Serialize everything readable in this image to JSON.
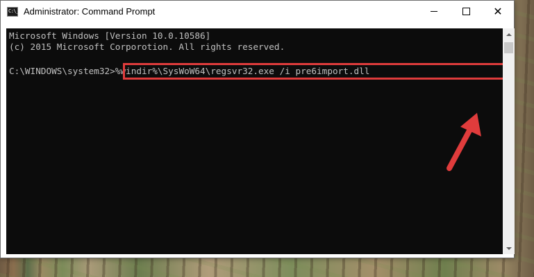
{
  "window": {
    "title": "Administrator: Command Prompt",
    "icon": "command-prompt-icon",
    "icon_glyph": "C:\\_"
  },
  "controls": {
    "minimize": "minimize-icon",
    "maximize": "maximize-icon",
    "close": "close-icon",
    "close_glyph": "✕"
  },
  "console": {
    "lines": [
      "Microsoft Windows [Version 10.0.10586]",
      "(c) 2015 Microsoft Corporotion. All rights reserved."
    ],
    "prompt": "C:\\WINDOWS\\system32>",
    "command": "%windir%\\SysWoW64\\regsvr32.exe /i pre6import.dll"
  },
  "colors": {
    "console_bg": "#0c0c0c",
    "console_text": "#c0c0c0",
    "highlight": "#e03c3c"
  }
}
